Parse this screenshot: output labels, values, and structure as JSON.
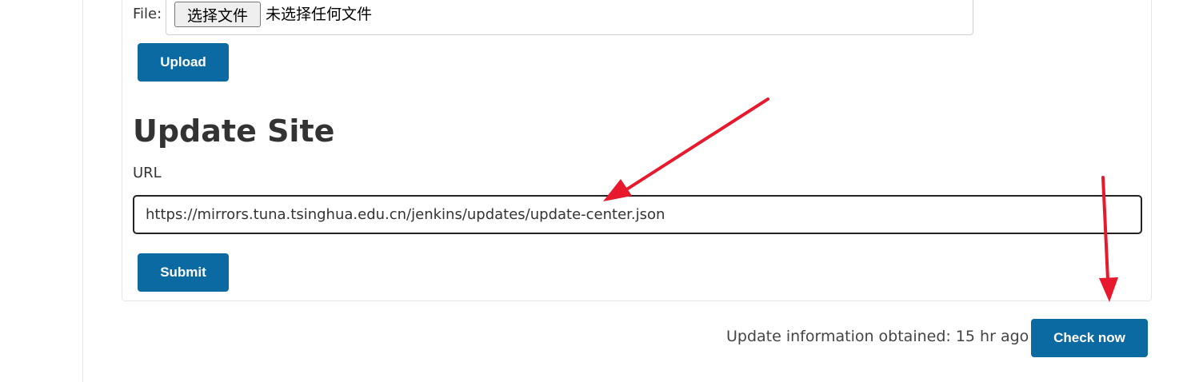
{
  "file_upload": {
    "label": "File:",
    "choose_button_label": "选择文件",
    "no_file_text": "未选择任何文件",
    "upload_button_label": "Upload"
  },
  "update_site": {
    "title": "Update Site",
    "url_label": "URL",
    "url_value": "https://mirrors.tuna.tsinghua.edu.cn/jenkins/updates/update-center.json",
    "submit_button_label": "Submit"
  },
  "status": {
    "update_info_text": "Update information obtained: 15 hr ago",
    "check_now_button_label": "Check now"
  },
  "colors": {
    "primary_button": "#0b6aa2",
    "annotation_arrow": "#e8192c"
  },
  "annotations": {
    "arrow_1_icon": "red-arrow-icon",
    "arrow_2_icon": "red-arrow-icon"
  }
}
